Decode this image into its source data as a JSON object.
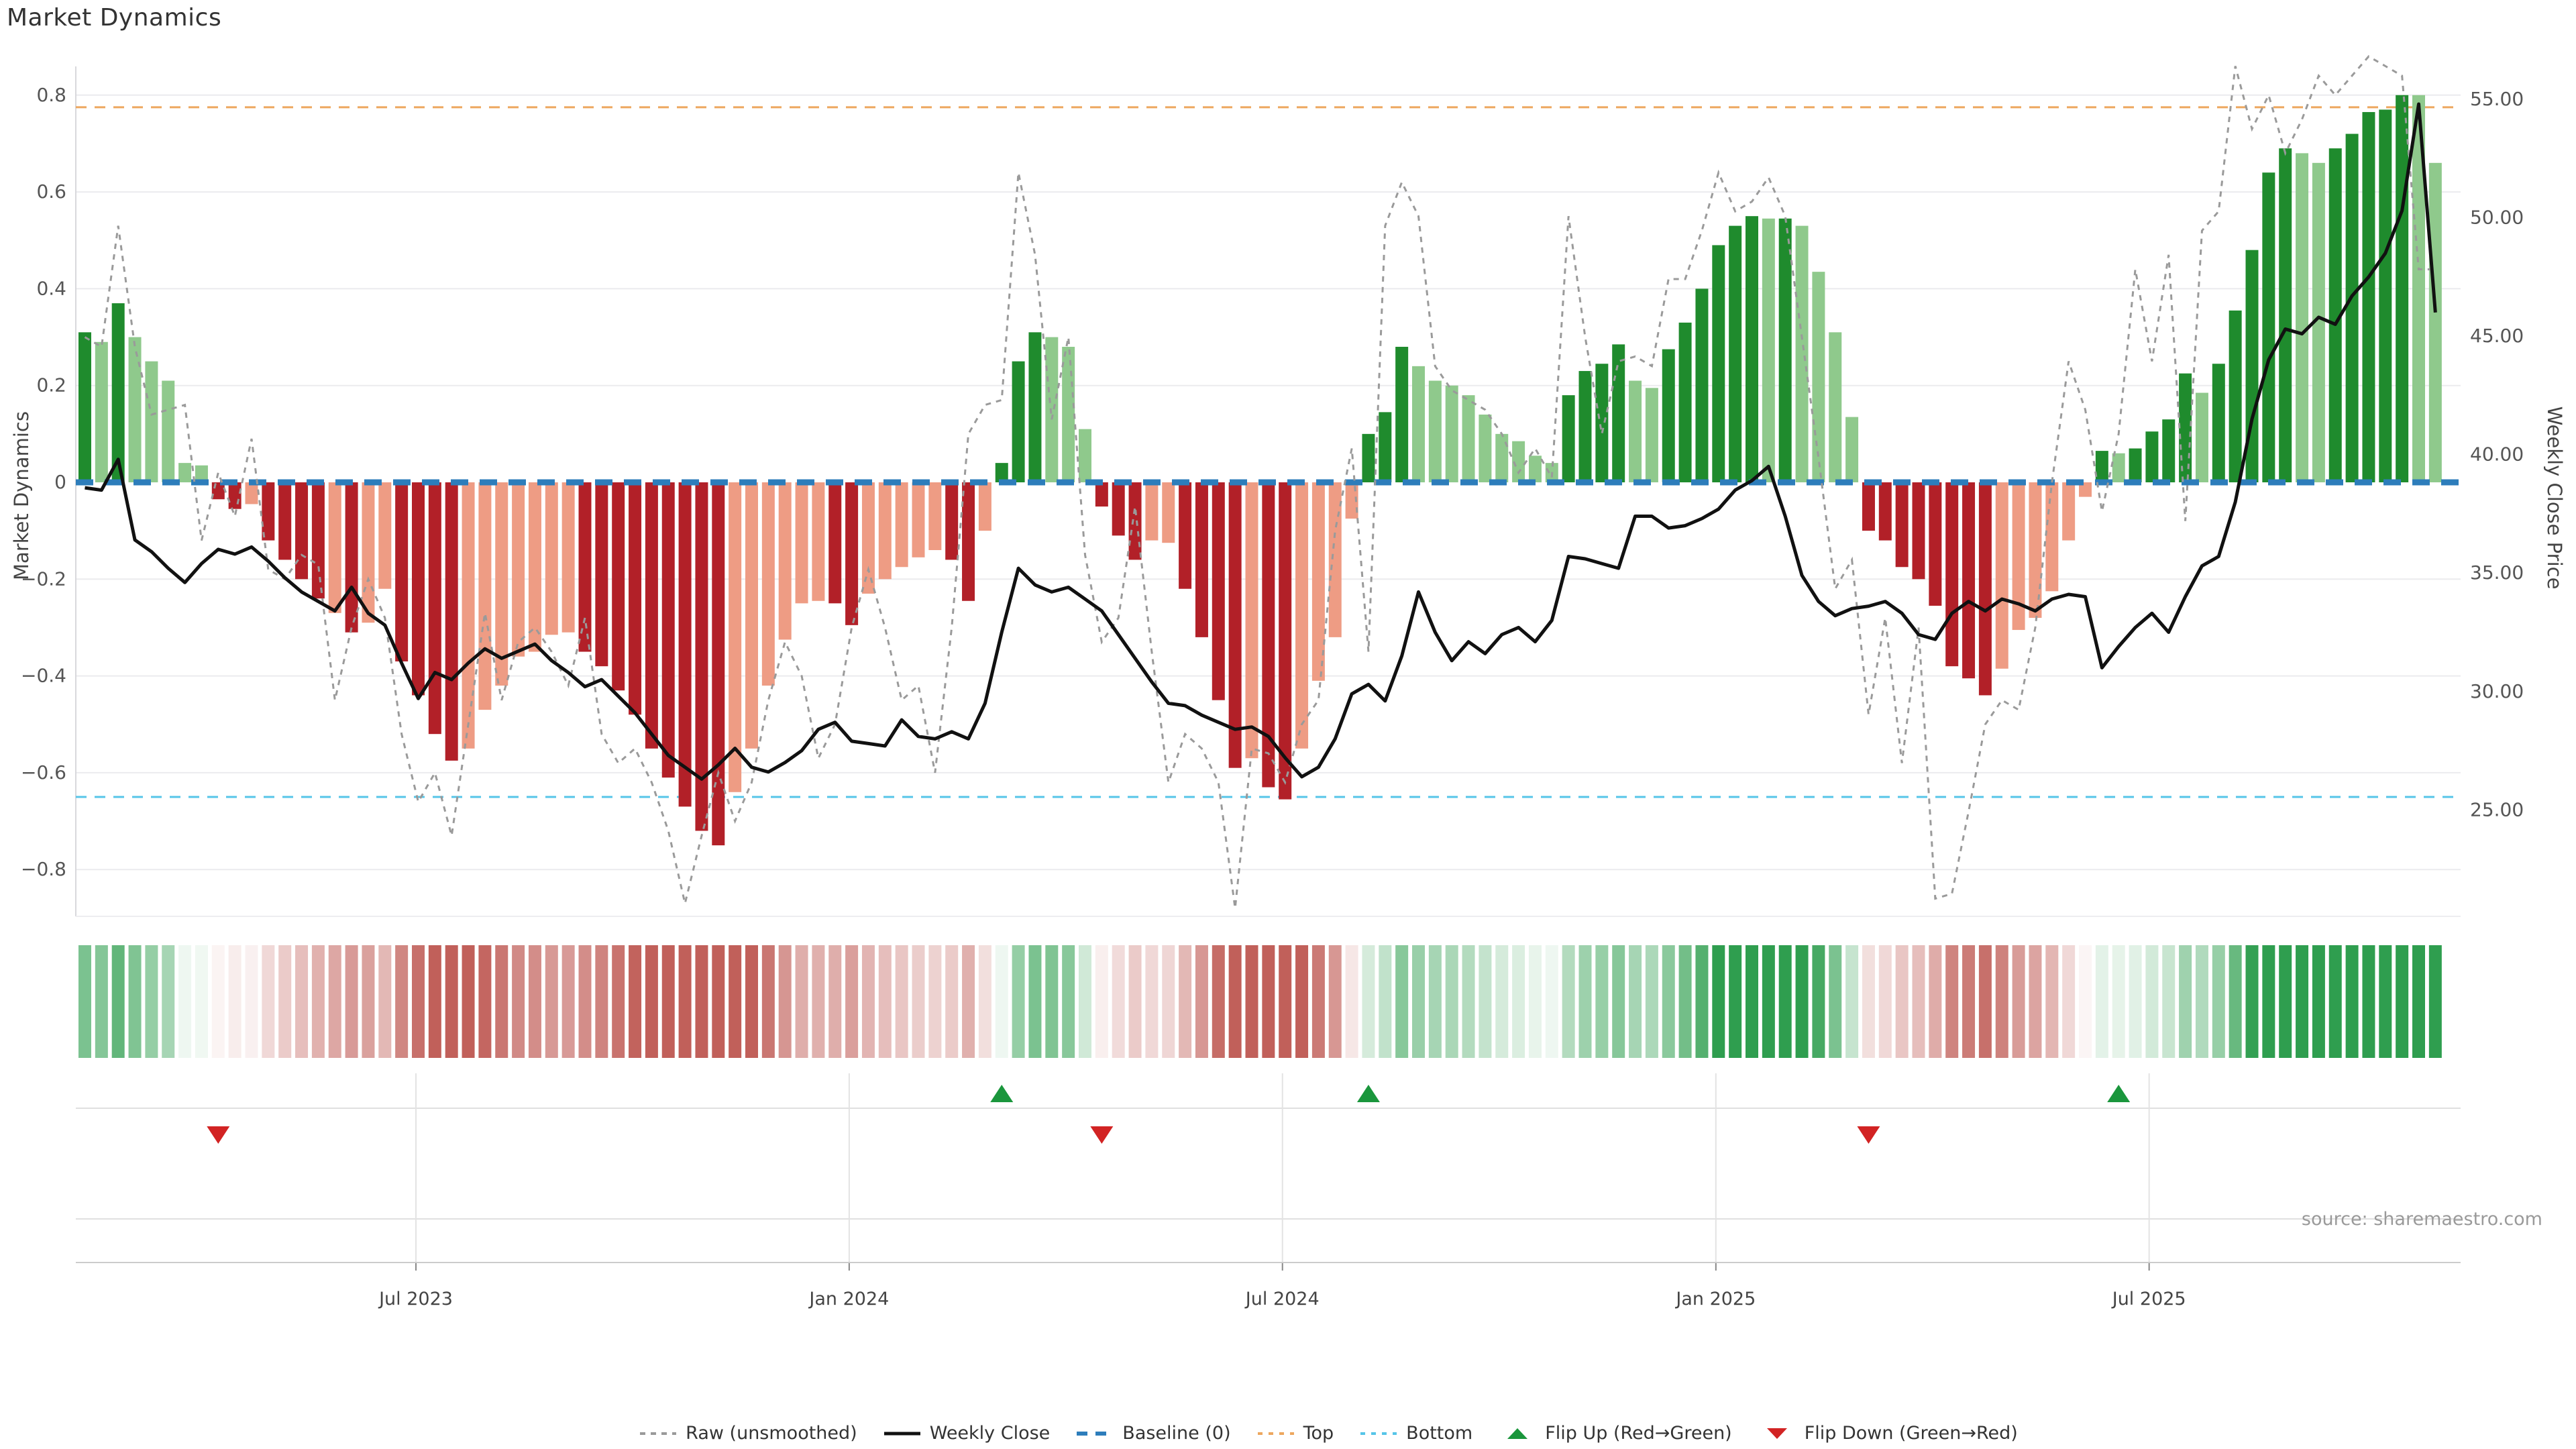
{
  "title": "Market Dynamics",
  "source": "source: sharemaestro.com",
  "axes": {
    "left_label": "Market Dynamics",
    "right_label": "Weekly Close Price",
    "left_ticks": [
      {
        "label": "0.8",
        "value": 0.8
      },
      {
        "label": "0.6",
        "value": 0.6
      },
      {
        "label": "0.4",
        "value": 0.4
      },
      {
        "label": "0.2",
        "value": 0.2
      },
      {
        "label": "0",
        "value": 0.0
      },
      {
        "label": "−0.2",
        "value": -0.2
      },
      {
        "label": "−0.4",
        "value": -0.4
      },
      {
        "label": "−0.6",
        "value": -0.6
      },
      {
        "label": "−0.8",
        "value": -0.8
      }
    ],
    "right_ticks": [
      {
        "label": "55.00",
        "value": 55
      },
      {
        "label": "50.00",
        "value": 50
      },
      {
        "label": "45.00",
        "value": 45
      },
      {
        "label": "40.00",
        "value": 40
      },
      {
        "label": "35.00",
        "value": 35
      },
      {
        "label": "30.00",
        "value": 30
      },
      {
        "label": "25.00",
        "value": 25
      }
    ],
    "x_ticks": [
      {
        "label": "Jul 2023",
        "week": 19.86
      },
      {
        "label": "Jan 2024",
        "week": 45.85
      },
      {
        "label": "Jul 2024",
        "week": 71.84
      },
      {
        "label": "Jan 2025",
        "week": 97.84
      },
      {
        "label": "Jul 2025",
        "week": 123.83
      }
    ]
  },
  "legend": [
    {
      "label": "Raw (unsmoothed)",
      "swatch": "dash-gray",
      "color": "#9a9a9a"
    },
    {
      "label": "Weekly Close",
      "swatch": "solid-black",
      "color": "#111111"
    },
    {
      "label": "Baseline (0)",
      "swatch": "dash-blue",
      "color": "#2d7dbb"
    },
    {
      "label": "Top",
      "swatch": "dot-orange",
      "color": "#eda75f"
    },
    {
      "label": "Bottom",
      "swatch": "dot-cyan",
      "color": "#56c5e8"
    },
    {
      "label": "Flip Up (Red→Green)",
      "swatch": "tri-up-green",
      "color": "#1a963c"
    },
    {
      "label": "Flip Down (Green→Red)",
      "swatch": "tri-down-red",
      "color": "#d22323"
    }
  ],
  "chart_data": {
    "type": "bar",
    "x_unit": "week",
    "n_weeks": 142,
    "ylim": [
      -0.9,
      0.86
    ],
    "ylim_right": [
      20.5,
      56.4
    ],
    "grid": true,
    "legend_position": "bottom-center",
    "series_names": [
      "Market Dynamics (bars)",
      "Raw (unsmoothed)",
      "Weekly Close"
    ],
    "reference_lines": {
      "baseline": {
        "label": "Baseline (0)",
        "value": 0.0,
        "color": "#2d7dbb"
      },
      "top": {
        "label": "Top",
        "value": 0.775,
        "color": "#eda75f"
      },
      "bottom": {
        "label": "Bottom",
        "value": -0.65,
        "color": "#56c5e8"
      }
    },
    "colors": {
      "bar_dark_green": "#1f8b2d",
      "bar_light_green": "#8fc98c",
      "bar_dark_red": "#b22028",
      "bar_light_red": "#ee9c84",
      "raw_line": "#9a9a9a",
      "price_line": "#111111",
      "heat_green": [
        47,
        158,
        79
      ],
      "heat_red": [
        193,
        96,
        90
      ],
      "flip_up": "#1a963c",
      "flip_down": "#d22323"
    },
    "values": [
      0.31,
      0.29,
      0.37,
      0.3,
      0.25,
      0.21,
      0.04,
      0.035,
      -0.035,
      -0.055,
      -0.045,
      -0.12,
      -0.16,
      -0.2,
      -0.24,
      -0.27,
      -0.31,
      -0.29,
      -0.22,
      -0.37,
      -0.44,
      -0.52,
      -0.575,
      -0.55,
      -0.47,
      -0.42,
      -0.36,
      -0.35,
      -0.315,
      -0.31,
      -0.35,
      -0.38,
      -0.43,
      -0.48,
      -0.55,
      -0.61,
      -0.67,
      -0.72,
      -0.75,
      -0.64,
      -0.55,
      -0.42,
      -0.325,
      -0.25,
      -0.245,
      -0.25,
      -0.295,
      -0.23,
      -0.2,
      -0.175,
      -0.155,
      -0.14,
      -0.16,
      -0.245,
      -0.1,
      0.04,
      0.25,
      0.31,
      0.3,
      0.28,
      0.11,
      -0.05,
      -0.11,
      -0.16,
      -0.12,
      -0.125,
      -0.22,
      -0.32,
      -0.45,
      -0.59,
      -0.57,
      -0.63,
      -0.655,
      -0.55,
      -0.41,
      -0.32,
      -0.075,
      0.1,
      0.145,
      0.28,
      0.24,
      0.21,
      0.2,
      0.18,
      0.14,
      0.1,
      0.085,
      0.055,
      0.04,
      0.18,
      0.23,
      0.245,
      0.285,
      0.21,
      0.195,
      0.275,
      0.33,
      0.4,
      0.49,
      0.53,
      0.55,
      0.545,
      0.545,
      0.53,
      0.435,
      0.31,
      0.135,
      -0.1,
      -0.12,
      -0.175,
      -0.2,
      -0.255,
      -0.38,
      -0.405,
      -0.44,
      -0.385,
      -0.305,
      -0.28,
      -0.225,
      -0.12,
      -0.03,
      0.065,
      0.06,
      0.07,
      0.105,
      0.13,
      0.225,
      0.185,
      0.245,
      0.355,
      0.48,
      0.64,
      0.69,
      0.68,
      0.66,
      0.69,
      0.72,
      0.765,
      0.77,
      0.8,
      0.8,
      0.66
    ],
    "shades": [
      "d",
      "l",
      "d",
      "l",
      "l",
      "l",
      "l",
      "l",
      "d",
      "d",
      "l",
      "d",
      "d",
      "d",
      "d",
      "l",
      "d",
      "l",
      "l",
      "d",
      "d",
      "d",
      "d",
      "l",
      "l",
      "l",
      "l",
      "l",
      "l",
      "l",
      "d",
      "d",
      "d",
      "d",
      "d",
      "d",
      "d",
      "d",
      "d",
      "l",
      "l",
      "l",
      "l",
      "l",
      "l",
      "d",
      "d",
      "l",
      "l",
      "l",
      "l",
      "l",
      "d",
      "d",
      "l",
      "d",
      "d",
      "d",
      "l",
      "l",
      "l",
      "d",
      "d",
      "d",
      "l",
      "l",
      "d",
      "d",
      "d",
      "d",
      "l",
      "d",
      "d",
      "l",
      "l",
      "l",
      "l",
      "d",
      "d",
      "d",
      "l",
      "l",
      "l",
      "l",
      "l",
      "l",
      "l",
      "l",
      "l",
      "d",
      "d",
      "d",
      "d",
      "l",
      "l",
      "d",
      "d",
      "d",
      "d",
      "d",
      "d",
      "l",
      "d",
      "l",
      "l",
      "l",
      "l",
      "d",
      "d",
      "d",
      "d",
      "d",
      "d",
      "d",
      "d",
      "l",
      "l",
      "l",
      "l",
      "l",
      "l",
      "d",
      "l",
      "d",
      "d",
      "d",
      "d",
      "l",
      "d",
      "d",
      "d",
      "d",
      "d",
      "l",
      "l",
      "d",
      "d",
      "d",
      "d",
      "d",
      "l",
      "l"
    ],
    "raw": [
      0.3,
      0.28,
      0.53,
      0.28,
      0.14,
      0.15,
      0.16,
      -0.12,
      0.02,
      -0.07,
      0.09,
      -0.18,
      -0.2,
      -0.15,
      -0.17,
      -0.45,
      -0.3,
      -0.2,
      -0.28,
      -0.52,
      -0.66,
      -0.6,
      -0.73,
      -0.5,
      -0.27,
      -0.45,
      -0.33,
      -0.3,
      -0.35,
      -0.42,
      -0.28,
      -0.52,
      -0.58,
      -0.55,
      -0.62,
      -0.72,
      -0.87,
      -0.73,
      -0.6,
      -0.7,
      -0.62,
      -0.45,
      -0.33,
      -0.4,
      -0.57,
      -0.5,
      -0.3,
      -0.18,
      -0.3,
      -0.45,
      -0.42,
      -0.6,
      -0.3,
      0.1,
      0.16,
      0.17,
      0.64,
      0.47,
      0.13,
      0.3,
      -0.15,
      -0.33,
      -0.28,
      -0.05,
      -0.35,
      -0.62,
      -0.52,
      -0.55,
      -0.62,
      -0.88,
      -0.55,
      -0.56,
      -0.62,
      -0.5,
      -0.45,
      -0.1,
      0.07,
      -0.35,
      0.53,
      0.62,
      0.55,
      0.24,
      0.19,
      0.17,
      0.15,
      0.1,
      0.02,
      0.07,
      0.01,
      0.55,
      0.3,
      0.1,
      0.25,
      0.26,
      0.24,
      0.42,
      0.42,
      0.52,
      0.64,
      0.56,
      0.58,
      0.63,
      0.55,
      0.3,
      0.05,
      -0.22,
      -0.16,
      -0.48,
      -0.28,
      -0.58,
      -0.3,
      -0.86,
      -0.85,
      -0.68,
      -0.5,
      -0.45,
      -0.47,
      -0.3,
      0.0,
      0.25,
      0.15,
      -0.06,
      0.1,
      0.44,
      0.25,
      0.47,
      -0.08,
      0.52,
      0.56,
      0.86,
      0.73,
      0.8,
      0.68,
      0.75,
      0.84,
      0.8,
      0.84,
      0.88,
      0.86,
      0.84,
      0.44,
      0.44
    ],
    "price": [
      38.6,
      38.5,
      39.8,
      36.4,
      35.9,
      35.2,
      34.6,
      35.4,
      36.0,
      35.8,
      36.1,
      35.5,
      34.8,
      34.2,
      33.8,
      33.4,
      34.4,
      33.3,
      32.8,
      31.2,
      29.7,
      30.8,
      30.5,
      31.2,
      31.8,
      31.4,
      31.7,
      32.0,
      31.3,
      30.8,
      30.2,
      30.5,
      29.8,
      29.1,
      28.2,
      27.3,
      26.8,
      26.3,
      26.9,
      27.6,
      26.8,
      26.6,
      27.0,
      27.5,
      28.4,
      28.7,
      27.9,
      27.8,
      27.7,
      28.8,
      28.1,
      28.0,
      28.3,
      28.0,
      29.5,
      32.5,
      35.2,
      34.5,
      34.2,
      34.4,
      33.9,
      33.4,
      32.4,
      31.4,
      30.4,
      29.5,
      29.4,
      29.0,
      28.7,
      28.4,
      28.5,
      28.1,
      27.2,
      26.4,
      26.8,
      28.0,
      29.9,
      30.3,
      29.6,
      31.5,
      34.2,
      32.5,
      31.3,
      32.1,
      31.6,
      32.4,
      32.7,
      32.1,
      33.0,
      35.7,
      35.6,
      35.4,
      35.2,
      37.4,
      37.4,
      36.9,
      37.0,
      37.3,
      37.7,
      38.5,
      38.9,
      39.5,
      37.4,
      34.9,
      33.8,
      33.2,
      33.5,
      33.6,
      33.8,
      33.3,
      32.4,
      32.2,
      33.3,
      33.8,
      33.4,
      33.9,
      33.7,
      33.4,
      33.9,
      34.1,
      34.0,
      31.0,
      31.9,
      32.7,
      33.3,
      32.5,
      34.0,
      35.3,
      35.7,
      38.0,
      41.5,
      44.0,
      45.3,
      45.1,
      45.8,
      45.5,
      46.7,
      47.5,
      48.5,
      50.3,
      54.8,
      46.0
    ],
    "flip_up_weeks": [
      55,
      77,
      122
    ],
    "flip_down_weeks": [
      8,
      61,
      107
    ]
  }
}
